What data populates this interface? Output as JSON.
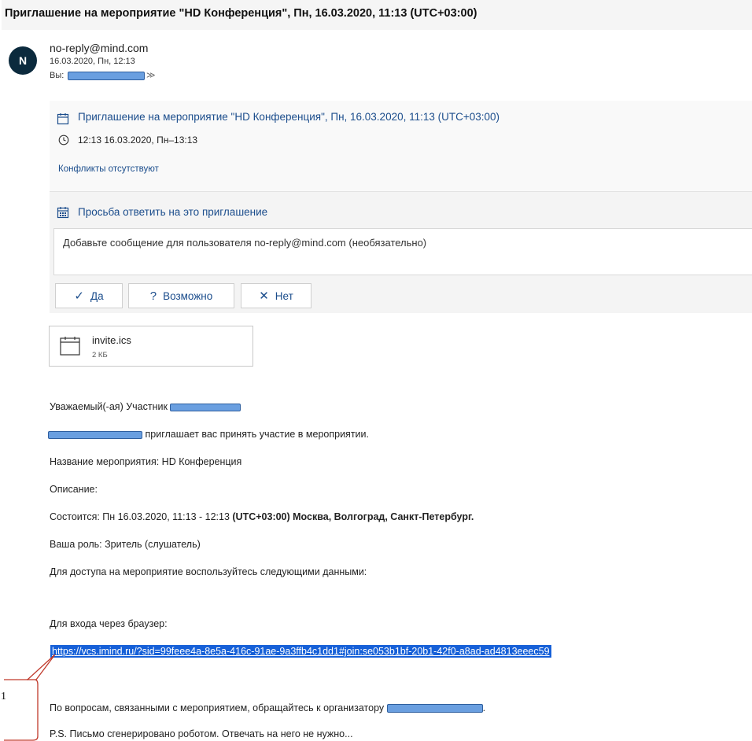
{
  "email": {
    "subject": "Приглашение на мероприятие \"HD Конференция\", Пн, 16.03.2020, 11:13 (UTC+03:00)",
    "avatar_letter": "N",
    "sender": "no-reply@mind.com",
    "date": "16.03.2020, Пн, 12:13",
    "to_label": "Вы:",
    "expand_icon": "chevron-down-icon"
  },
  "event": {
    "title": "Приглашение на мероприятие \"HD Конференция\", Пн, 16.03.2020, 11:13 (UTC+03:00)",
    "time": "12:13 16.03.2020, Пн–13:13",
    "conflicts": "Конфликты отсутствуют",
    "rsvp_title": "Просьба ответить на это приглашение",
    "message_placeholder": "Добавьте сообщение для пользователя no-reply@mind.com (необязательно)",
    "buttons": {
      "yes": "Да",
      "maybe": "Возможно",
      "no": "Нет"
    }
  },
  "attachment": {
    "name": "invite.ics",
    "size": "2 КБ"
  },
  "body": {
    "greeting": "Уважаемый(-ая) Участник",
    "invite_line": "приглашает вас принять участие в мероприятии.",
    "event_name": "Название мероприятия: HD Конференция",
    "description": "Описание:",
    "schedule_prefix": "Состоится: Пн 16.03.2020, 11:13 - 12:13 ",
    "schedule_bold": "(UTC+03:00) Москва, Волгоград, Санкт-Петербург.",
    "role": "Ваша роль: Зритель (слушатель)",
    "access": "Для доступа на мероприятие воспользуйтесь следующими данными:",
    "browser_entry": "Для входа через браузер:",
    "link": "https://vcs.imind.ru/?sid=99feee4a-8e5a-416c-91ae-9a3ffb4c1dd1#join:se053b1bf-20b1-42f0-a8ad-ad4813eeec59",
    "questions": "По вопросам, связанными с мероприятием, обращайтесь к организатору",
    "ps": "P.S. Письмо сгенерировано роботом. Отвечать на него не нужно..."
  },
  "callout": {
    "label": "1"
  },
  "colors": {
    "accent": "#1b4d8c",
    "link_highlight": "#1660d8",
    "redaction": "#6a9fe0",
    "callout_stroke": "#c0392b"
  }
}
